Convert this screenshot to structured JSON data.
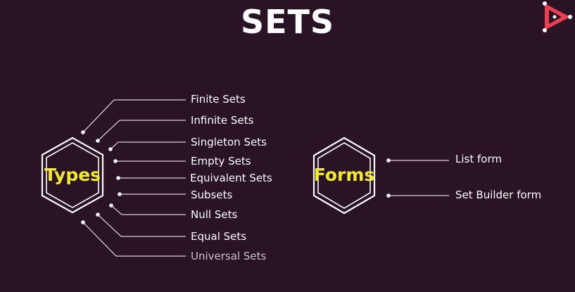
{
  "title": "SETS",
  "logo": {
    "icon": "play-triangle-logo-icon"
  },
  "types": {
    "label": "Types",
    "items": [
      "Finite Sets",
      "Infinite Sets",
      "Singleton Sets",
      "Empty Sets",
      "Equivalent Sets",
      "Subsets",
      "Null Sets",
      "Equal Sets",
      "Universal Sets"
    ]
  },
  "forms": {
    "label": "Forms",
    "items": [
      "List form",
      "Set Builder form"
    ]
  },
  "colors": {
    "background": "#2b1326",
    "accent": "#f2ea2c",
    "text": "#ffffff",
    "logo": "#e8404e"
  }
}
